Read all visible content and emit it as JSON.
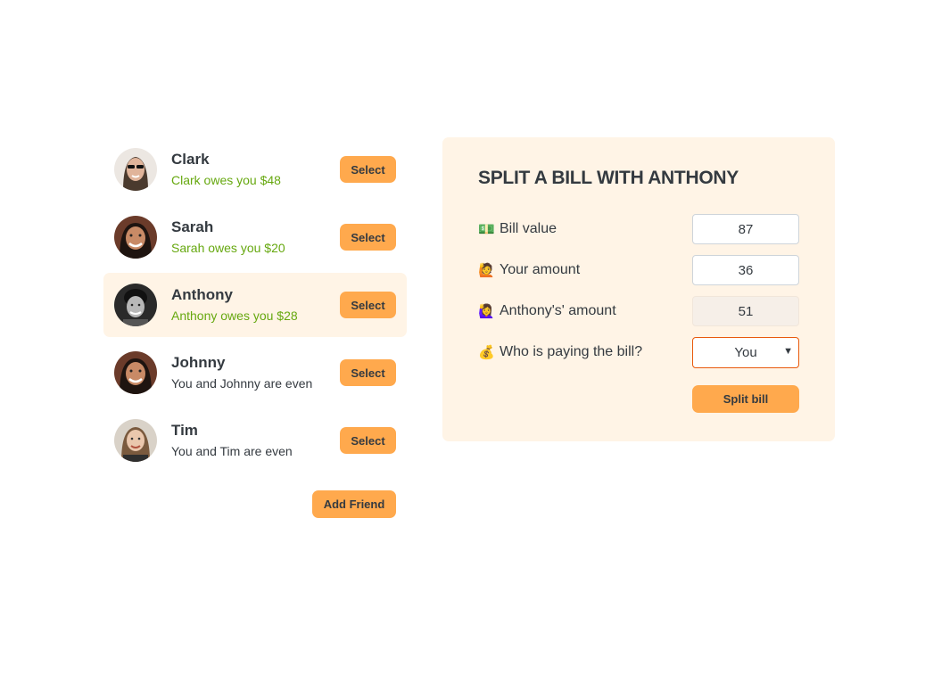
{
  "friends": [
    {
      "name": "Clark",
      "status": "Clark owes you $48",
      "status_color": "#66a80f",
      "select_label": "Select",
      "avatar": "clark-avatar",
      "selected": false
    },
    {
      "name": "Sarah",
      "status": "Sarah owes you $20",
      "status_color": "#66a80f",
      "select_label": "Select",
      "avatar": "sarah-avatar",
      "selected": false
    },
    {
      "name": "Anthony",
      "status": "Anthony owes you $28",
      "status_color": "#66a80f",
      "select_label": "Select",
      "avatar": "anthony-avatar",
      "selected": true
    },
    {
      "name": "Johnny",
      "status": "You and Johnny are even",
      "status_color": "#343a40",
      "select_label": "Select",
      "avatar": "johnny-avatar",
      "selected": false
    },
    {
      "name": "Tim",
      "status": "You and Tim are even",
      "status_color": "#343a40",
      "select_label": "Select",
      "avatar": "tim-avatar",
      "selected": false
    }
  ],
  "add_friend_label": "Add Friend",
  "split_form": {
    "title": "Split a bill with Anthony",
    "bill_label": "Bill value",
    "bill_icon": "💵",
    "bill_value": "87",
    "your_label": "Your amount",
    "your_icon": "🙋",
    "your_value": "36",
    "friend_label": "Anthony's' amount",
    "friend_icon": "🙋‍♀️",
    "friend_value": "51",
    "payer_label": "Who is paying the bill?",
    "payer_icon": "💰",
    "payer_value": "You",
    "split_label": "Split bill"
  },
  "colors": {
    "accent": "#ffa94d",
    "panel_bg": "#fff4e6",
    "positive": "#66a80f",
    "text": "#343a40"
  }
}
